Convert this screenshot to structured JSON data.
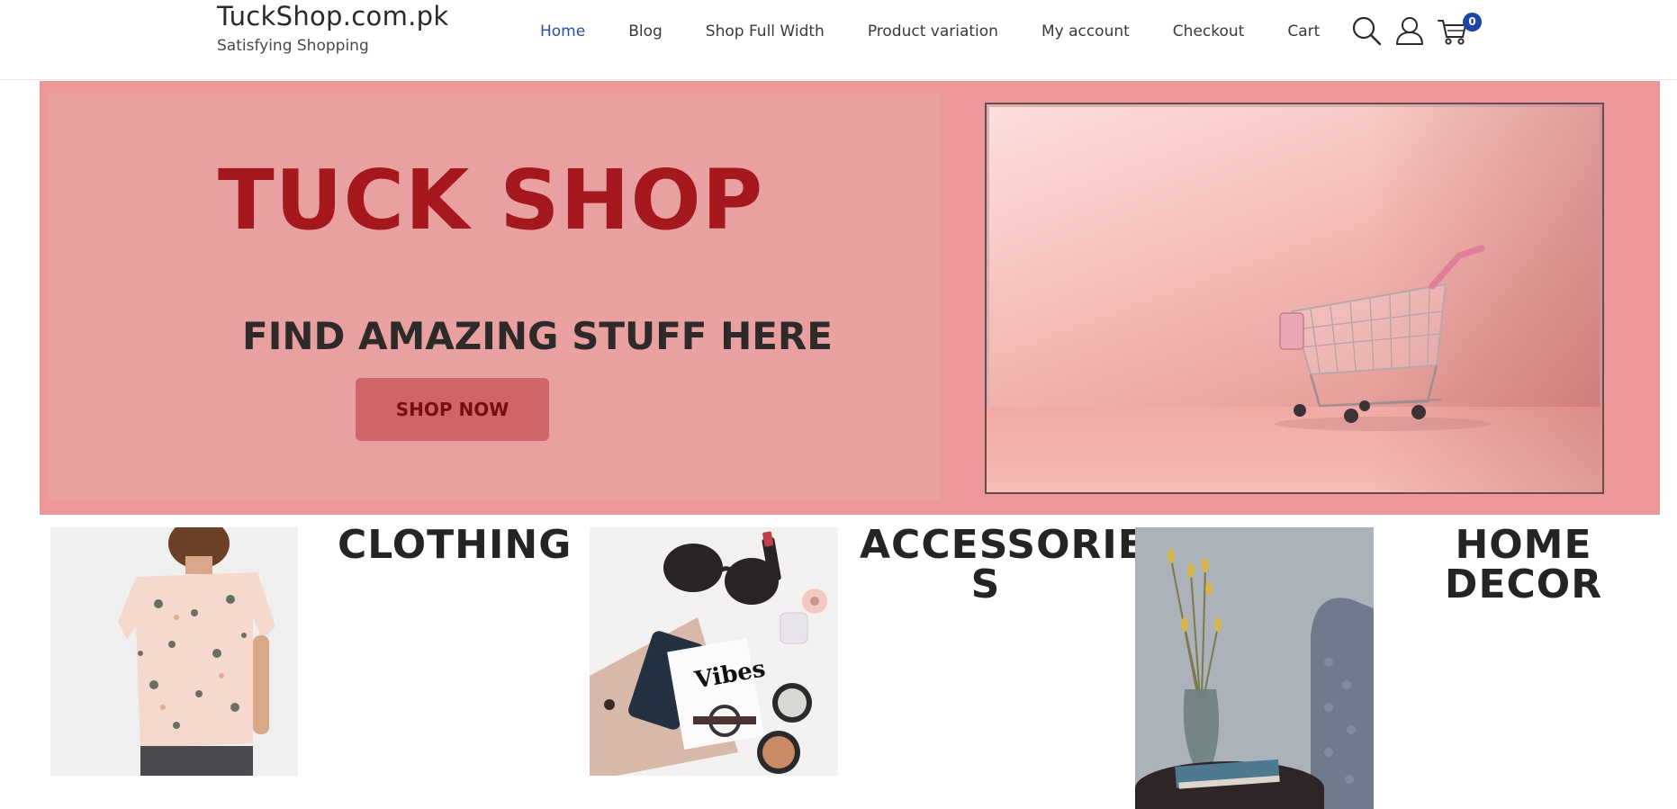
{
  "header": {
    "site_title": "TuckShop.com.pk",
    "tagline": "Satisfying Shopping",
    "nav": [
      {
        "label": "Home",
        "active": true
      },
      {
        "label": "Blog"
      },
      {
        "label": "Shop Full Width"
      },
      {
        "label": "Product variation"
      },
      {
        "label": "My account"
      },
      {
        "label": "Checkout"
      },
      {
        "label": "Cart"
      }
    ],
    "icons": [
      "search-icon",
      "user-icon",
      "cart-icon"
    ],
    "cart_count": "0",
    "accent_color": "#2a4fa8",
    "badge_color": "#1f44a8"
  },
  "hero": {
    "title": "TUCK SHOP",
    "subtitle": "FIND AMAZING STUFF HERE",
    "button_label": "SHOP NOW",
    "image_alt": "shopping-cart-photo",
    "background_color": "#ec9799",
    "title_color": "#a4181e"
  },
  "categories": [
    {
      "title": "CLOTHING",
      "image": "floral-shirt-photo"
    },
    {
      "title": "ACCESSORIES",
      "title_lines": [
        "ACCESSORIE",
        "S"
      ],
      "image": "accessories-flatlay-photo"
    },
    {
      "title": "HOME DECOR",
      "title_lines": [
        "HOME",
        "DECOR"
      ],
      "image": "vase-chair-photo"
    }
  ]
}
